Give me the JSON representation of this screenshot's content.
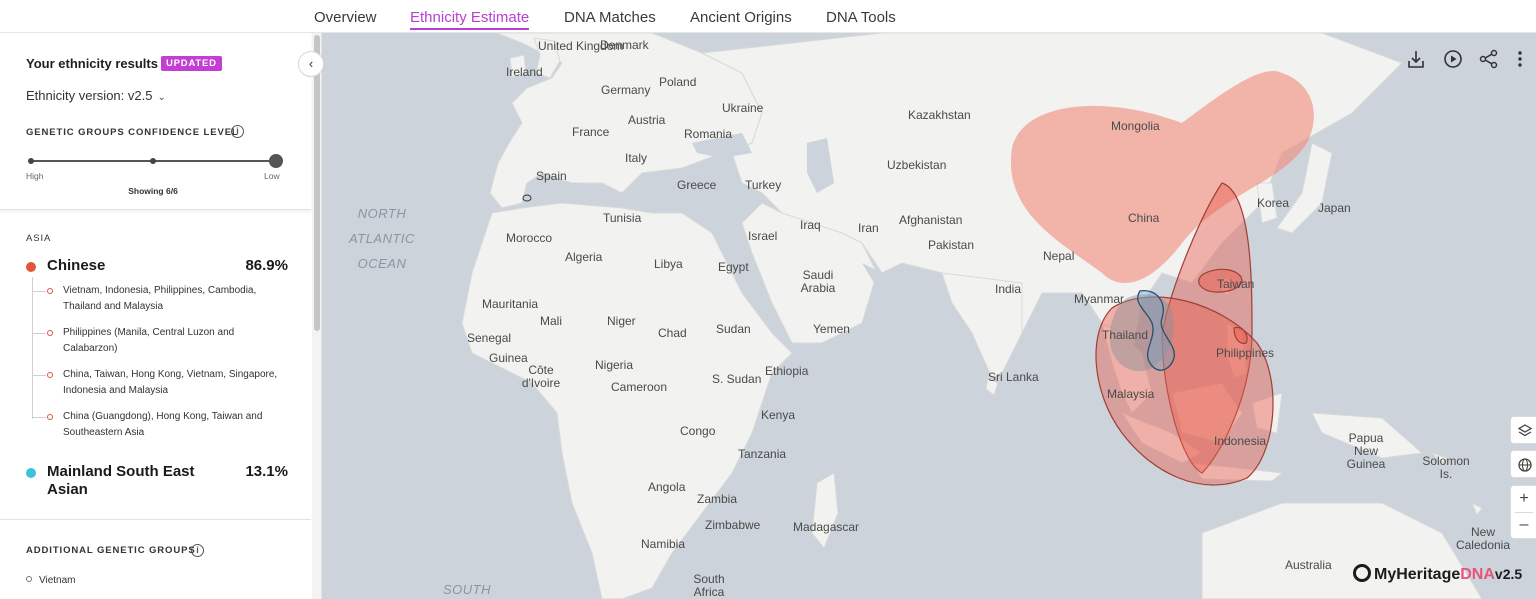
{
  "nav": {
    "tabs": [
      "Overview",
      "Ethnicity Estimate",
      "DNA Matches",
      "Ancient Origins",
      "DNA Tools"
    ],
    "active_tab": "Ethnicity Estimate"
  },
  "sidebar": {
    "title": "Your ethnicity results",
    "badge": "UPDATED",
    "version_label": "Ethnicity version: v2.5",
    "confidence_title": "GENETIC GROUPS CONFIDENCE LEVEL",
    "confidence_level": "Low",
    "slider_high_label": "High",
    "slider_low_label": "Low",
    "showing": "Showing 6/6",
    "region": "ASIA",
    "groups": [
      {
        "name": "Chinese",
        "percent": "86.9%",
        "color": "#e0573d",
        "sub_groups": [
          "Vietnam, Indonesia, Philippines, Cambodia, Thailand and Malaysia",
          "Philippines (Manila, Central Luzon and Calabarzon)",
          "China, Taiwan, Hong Kong, Vietnam, Singapore, Indonesia and Malaysia",
          "China (Guangdong), Hong Kong, Taiwan and Southeastern Asia"
        ]
      },
      {
        "name": "Mainland South East Asian",
        "percent": "13.1%",
        "color": "#3cc2d9"
      }
    ],
    "additional_title": "ADDITIONAL GENETIC GROUPS",
    "additional_items": [
      "Vietnam"
    ]
  },
  "map": {
    "labels": {
      "uk": "United Kingdom",
      "ireland": "Ireland",
      "denmark": "Denmark",
      "poland": "Poland",
      "germany": "Germany",
      "ukraine": "Ukraine",
      "austria": "Austria",
      "france": "France",
      "romania": "Romania",
      "italy": "Italy",
      "spain": "Spain",
      "greece": "Greece",
      "turkey": "Turkey",
      "kazakhstan": "Kazakhstan",
      "mongolia": "Mongolia",
      "uzbekistan": "Uzbekistan",
      "china": "China",
      "korea": "Korea",
      "japan": "Japan",
      "tunisia": "Tunisia",
      "morocco": "Morocco",
      "algeria": "Algeria",
      "libya": "Libya",
      "egypt": "Egypt",
      "israel": "Israel",
      "iraq": "Iraq",
      "iran": "Iran",
      "afghanistan": "Afghanistan",
      "pakistan": "Pakistan",
      "nepal": "Nepal",
      "saudi_arabia": "Saudi Arabia",
      "india": "India",
      "myanmar": "Myanmar",
      "taiwan": "Taiwan",
      "mauritania": "Mauritania",
      "mali": "Mali",
      "niger": "Niger",
      "chad": "Chad",
      "sudan": "Sudan",
      "yemen": "Yemen",
      "thailand": "Thailand",
      "philippines": "Philippines",
      "senegal": "Senegal",
      "guinea": "Guinea",
      "cote_divoire": "Côte d'Ivoire",
      "nigeria": "Nigeria",
      "cameroon": "Cameroon",
      "s_sudan": "S. Sudan",
      "ethiopia": "Ethiopia",
      "sri_lanka": "Sri Lanka",
      "malaysia": "Malaysia",
      "kenya": "Kenya",
      "congo": "Congo",
      "tanzania": "Tanzania",
      "indonesia": "Indonesia",
      "papua_new_guinea": "Papua New Guinea",
      "solomon_is": "Solomon Is.",
      "angola": "Angola",
      "zambia": "Zambia",
      "zimbabwe": "Zimbabwe",
      "madagascar": "Madagascar",
      "namibia": "Namibia",
      "new_caledonia": "New Caledonia",
      "australia": "Australia",
      "south_africa": "South Africa",
      "north_atlantic": "NORTH ATLANTIC OCEAN",
      "south_ocean": "SOUTH"
    },
    "logo": {
      "brand": "MyHeritage",
      "dna": "DNA",
      "version": "v2.5"
    }
  }
}
